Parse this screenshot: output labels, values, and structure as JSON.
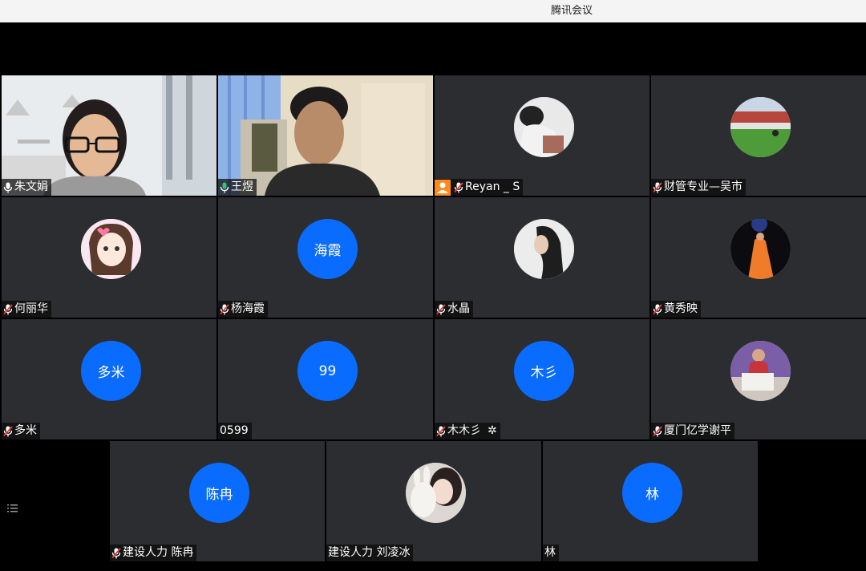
{
  "window": {
    "title": "腾讯会议"
  },
  "participants": [
    {
      "name": "朱文娟",
      "kind": "video",
      "mic": "on"
    },
    {
      "name": "王煜",
      "kind": "video",
      "mic": "speaking"
    },
    {
      "name": "Reyan _ S",
      "kind": "photo",
      "mic": "muted",
      "host": true
    },
    {
      "name": "财管专业—吴市",
      "kind": "photo",
      "mic": "muted"
    },
    {
      "name": "何丽华",
      "kind": "photo",
      "mic": "muted"
    },
    {
      "name": "杨海霞",
      "kind": "text",
      "avatar_text": "海霞",
      "mic": "muted"
    },
    {
      "name": "水晶",
      "kind": "photo",
      "mic": "muted"
    },
    {
      "name": "黄秀映",
      "kind": "photo",
      "mic": "muted"
    },
    {
      "name": "多米",
      "kind": "text",
      "avatar_text": "多米",
      "mic": "muted"
    },
    {
      "name": "0599",
      "kind": "text",
      "avatar_text": "99",
      "mic": "none"
    },
    {
      "name": "木木彡",
      "kind": "text",
      "avatar_text": "木彡",
      "mic": "muted",
      "badge": "gear-icon"
    },
    {
      "name": "厦门亿学谢平",
      "kind": "photo",
      "mic": "muted"
    },
    {
      "name": "建设人力 陈冉",
      "kind": "text",
      "avatar_text": "陈冉",
      "mic": "muted"
    },
    {
      "name": "建设人力 刘凌冰",
      "kind": "photo",
      "mic": "none"
    },
    {
      "name": "林",
      "kind": "text",
      "avatar_text": "林",
      "mic": "none"
    }
  ],
  "colors": {
    "avatar_blue": "#0a6cff",
    "tile_bg": "#2b2d30",
    "speaking": "#39c26a",
    "muted": "#e0413c",
    "host": "#ff8a1e"
  },
  "icons": {
    "mic_on": "microphone-icon",
    "mic_muted": "microphone-muted-icon",
    "host": "host-icon",
    "menu": "list-menu-icon"
  }
}
